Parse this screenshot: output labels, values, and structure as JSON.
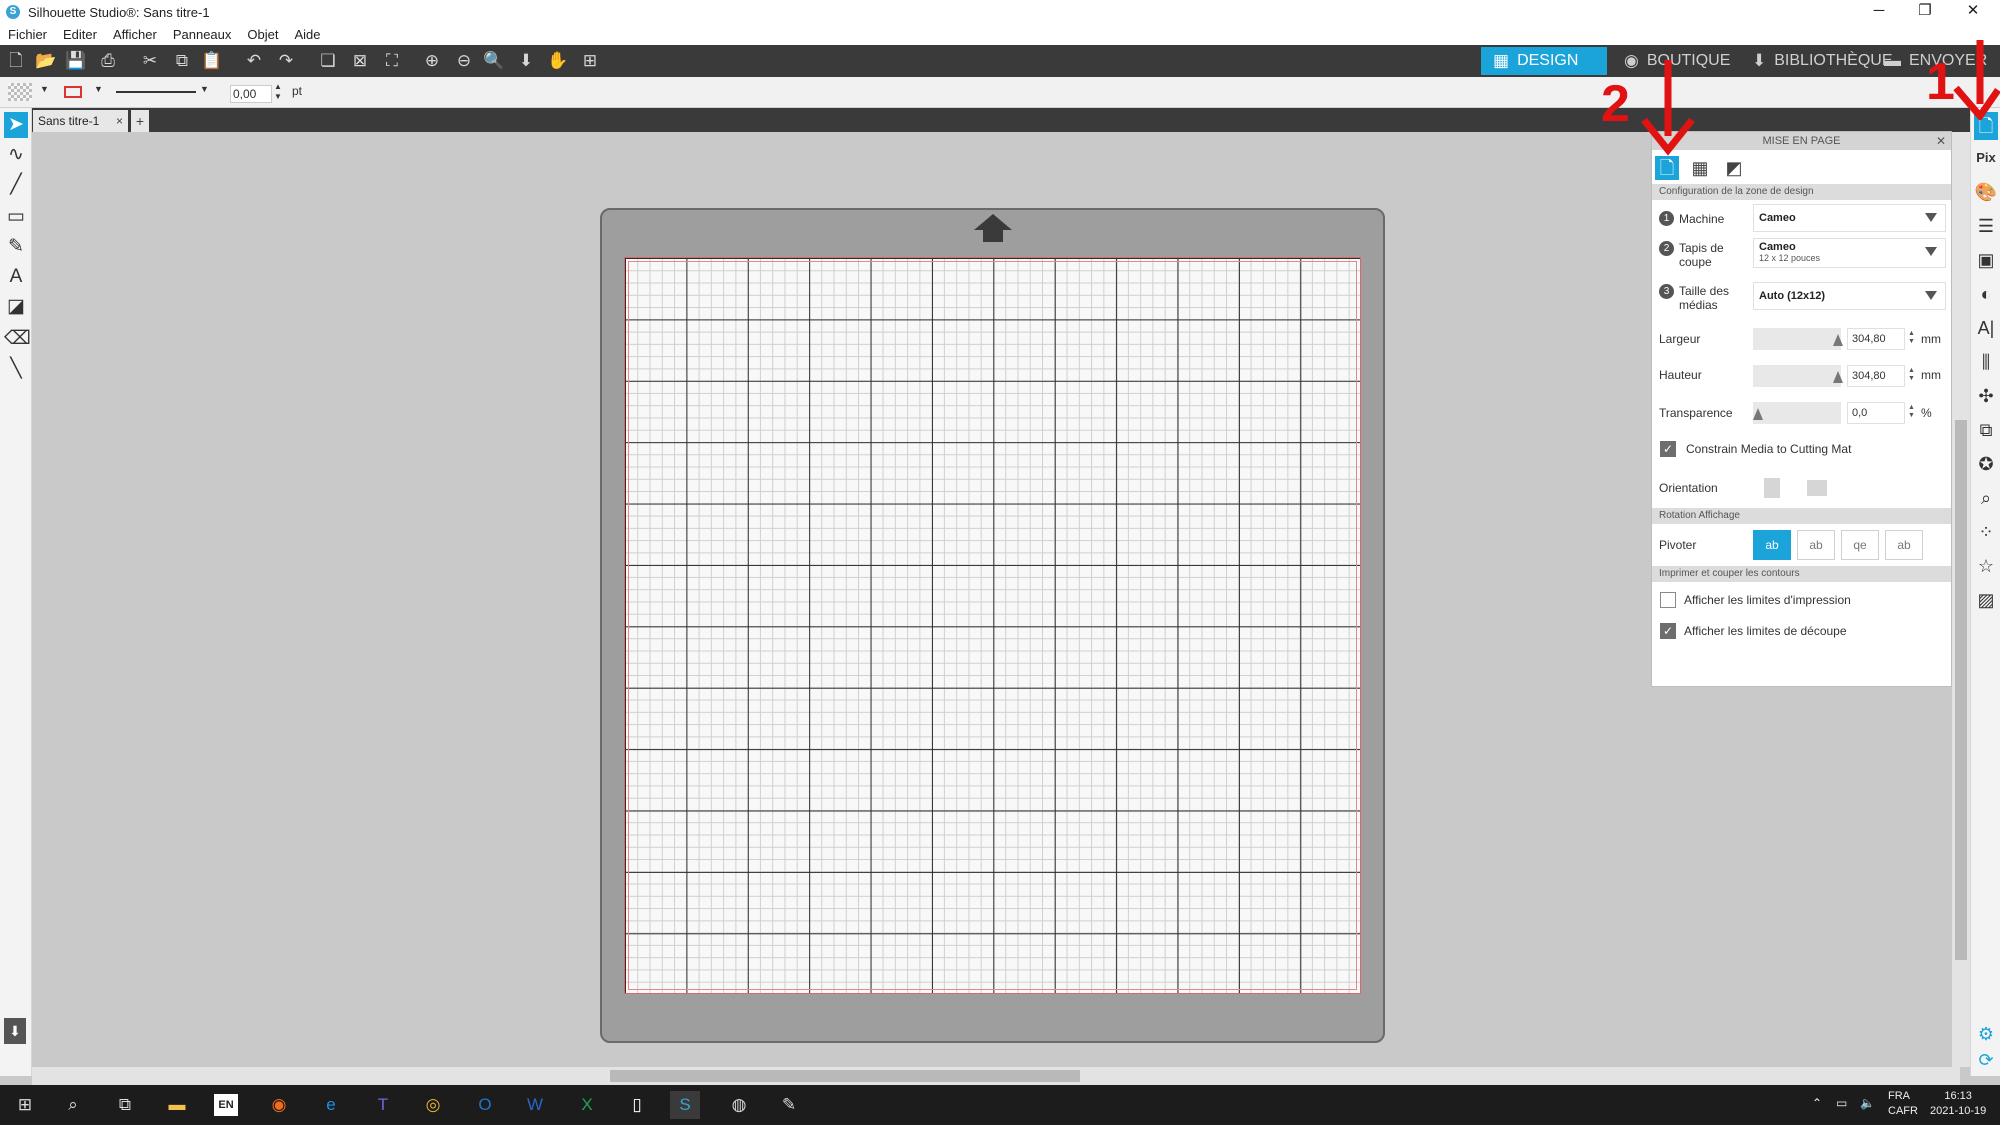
{
  "window": {
    "title": "Silhouette Studio®: Sans titre-1",
    "minimize": "─",
    "maximize": "❐",
    "close": "✕"
  },
  "menu": [
    "Fichier",
    "Editer",
    "Afficher",
    "Panneaux",
    "Objet",
    "Aide"
  ],
  "nav_tabs": [
    {
      "label": "DESIGN",
      "active": true,
      "icon": "grid-icon"
    },
    {
      "label": "BOUTIQUE",
      "active": false,
      "icon": "store-icon"
    },
    {
      "label": "BIBLIOTHÈQUE",
      "active": false,
      "icon": "library-icon"
    },
    {
      "label": "ENVOYER",
      "active": false,
      "icon": "send-icon"
    }
  ],
  "propbar": {
    "line_width": "0,00",
    "unit": "pt"
  },
  "document_tab": {
    "label": "Sans titre-1",
    "close": "×",
    "add": "+"
  },
  "panel": {
    "title": "MISE EN PAGE",
    "close": "✕",
    "section_design": "Configuration de la zone de design",
    "machine": {
      "num": "1",
      "label": "Machine",
      "value": "Cameo"
    },
    "mat": {
      "num": "2",
      "label": "Tapis de coupe",
      "value": "Cameo",
      "sub": "12 x 12 pouces"
    },
    "media": {
      "num": "3",
      "label": "Taille des médias",
      "value": "Auto (12x12)"
    },
    "width": {
      "label": "Largeur",
      "value": "304,80",
      "unit": "mm"
    },
    "height": {
      "label": "Hauteur",
      "value": "304,80",
      "unit": "mm"
    },
    "transparency": {
      "label": "Transparence",
      "value": "0,0",
      "unit": "%"
    },
    "constrain": {
      "label": "Constrain Media to Cutting Mat",
      "checked": true
    },
    "orientation": {
      "label": "Orientation"
    },
    "section_rotation": "Rotation Affichage",
    "rotate": {
      "label": "Pivoter",
      "buttons": [
        "ab",
        "ab",
        "qe",
        "ab"
      ]
    },
    "section_print": "Imprimer et couper les contours",
    "print_limits": {
      "label": "Afficher les limites d'impression",
      "checked": false
    },
    "cut_limits": {
      "label": "Afficher les limites de découpe",
      "checked": true
    }
  },
  "annotations": {
    "one": "1",
    "two": "2",
    "color": "#e01212"
  },
  "accent_color": "#1aa4d9",
  "taskbar": {
    "lang": "EN",
    "tray_lang": "FRA",
    "tray_region": "CAFR",
    "time": "16:13",
    "date": "2021-10-19"
  }
}
